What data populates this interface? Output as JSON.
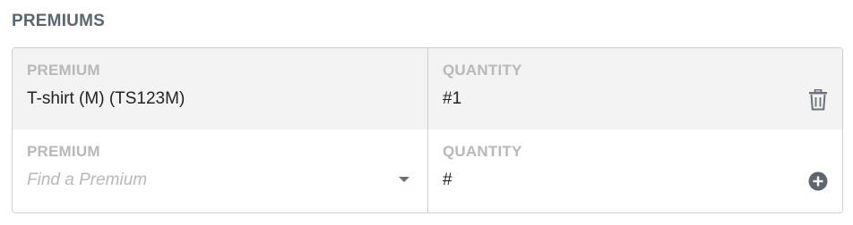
{
  "section": {
    "title": "PREMIUMS"
  },
  "rows": [
    {
      "premium_label": "PREMIUM",
      "premium_value": "T-shirt (M) (TS123M)",
      "quantity_label": "QUANTITY",
      "quantity_value": "#1",
      "action_icon": "trash-icon"
    },
    {
      "premium_label": "PREMIUM",
      "premium_placeholder": "Find a Premium",
      "quantity_label": "QUANTITY",
      "quantity_value": "#",
      "action_icon": "plus-circle-icon"
    }
  ],
  "colors": {
    "label": "#b8b8b8",
    "title": "#5b6770",
    "icon": "#6b7178",
    "row_highlight": "#f3f3f3"
  }
}
